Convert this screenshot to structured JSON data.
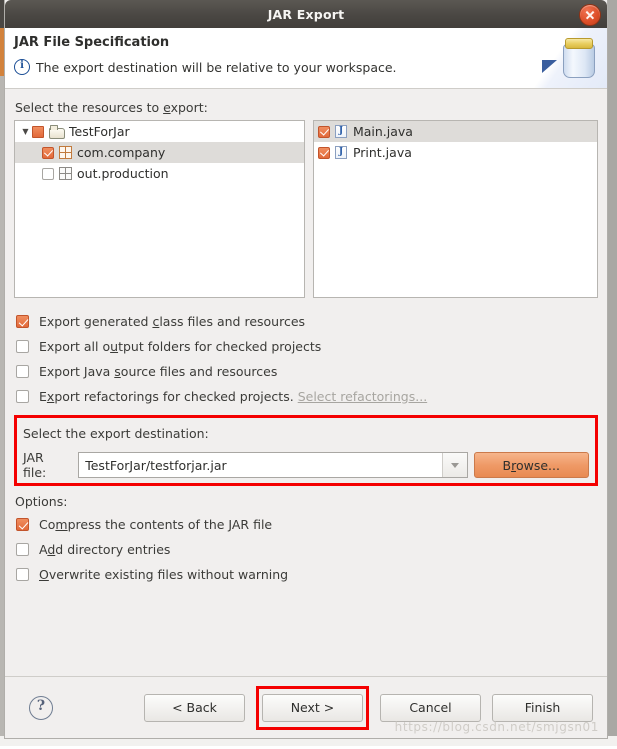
{
  "window": {
    "title": "JAR Export",
    "close_icon": "close-icon"
  },
  "header": {
    "title": "JAR File Specification",
    "info_icon": "info-icon",
    "description": "The export destination will be relative to your workspace.",
    "graphic": "jar-icon"
  },
  "resources": {
    "label_pre": "Select the resources to ",
    "label_mnemonic": "e",
    "label_post": "xport:",
    "tree": [
      {
        "name": "TestForJar",
        "check": "partial",
        "icon": "folder-icon",
        "depth": 0,
        "twisty": "▼",
        "selected": false
      },
      {
        "name": "com.company",
        "check": "checked",
        "icon": "package-icon",
        "depth": 1,
        "twisty": "",
        "selected": true
      },
      {
        "name": "out.production",
        "check": "unchecked",
        "icon": "package-icon-gray",
        "depth": 1,
        "twisty": "",
        "selected": false
      }
    ],
    "files": [
      {
        "name": "Main.java",
        "check": "checked",
        "icon": "java-file-icon",
        "glyph": "J",
        "selected": true
      },
      {
        "name": "Print.java",
        "check": "checked",
        "icon": "java-file-icon",
        "glyph": "J",
        "selected": false
      }
    ]
  },
  "export_options": [
    {
      "checked": true,
      "pre": "Export generated ",
      "mnemonic": "c",
      "post": "lass files and resources",
      "link": null
    },
    {
      "checked": false,
      "pre": "Export all o",
      "mnemonic": "u",
      "post": "tput folders for checked projects",
      "link": null
    },
    {
      "checked": false,
      "pre": "Export Java ",
      "mnemonic": "s",
      "post": "ource files and resources",
      "link": null
    },
    {
      "checked": false,
      "pre": "E",
      "mnemonic": "x",
      "post": "port refactorings for checked projects.",
      "link": "Select refactorings..."
    }
  ],
  "destination": {
    "label": "Select the export destination:",
    "jarfile_label_pre": "",
    "jarfile_label_mnemonic": "J",
    "jarfile_label_post": "AR file:",
    "jarfile_value": "TestForJar/testforjar.jar",
    "jarfile_placeholder": "",
    "dropdown_icon": "chevron-down-icon",
    "browse_pre": "B",
    "browse_mnemonic": "r",
    "browse_post": "owse...",
    "highlight_color": "#f40000"
  },
  "options": {
    "label": "Options:",
    "items": [
      {
        "checked": true,
        "pre": "Co",
        "mnemonic": "m",
        "post": "press the contents of the JAR file"
      },
      {
        "checked": false,
        "pre": "A",
        "mnemonic": "d",
        "post": "d directory entries"
      },
      {
        "checked": false,
        "pre": "",
        "mnemonic": "O",
        "post": "verwrite existing files without warning"
      }
    ]
  },
  "footer": {
    "help_icon": "help-icon",
    "help_glyph": "?",
    "buttons": [
      {
        "label": "< Back",
        "highlighted": false
      },
      {
        "label": "Next >",
        "highlighted": true
      },
      {
        "label": "Cancel",
        "highlighted": false
      },
      {
        "label": "Finish",
        "highlighted": false
      }
    ],
    "watermark": "https://blog.csdn.net/smjgsn01"
  }
}
